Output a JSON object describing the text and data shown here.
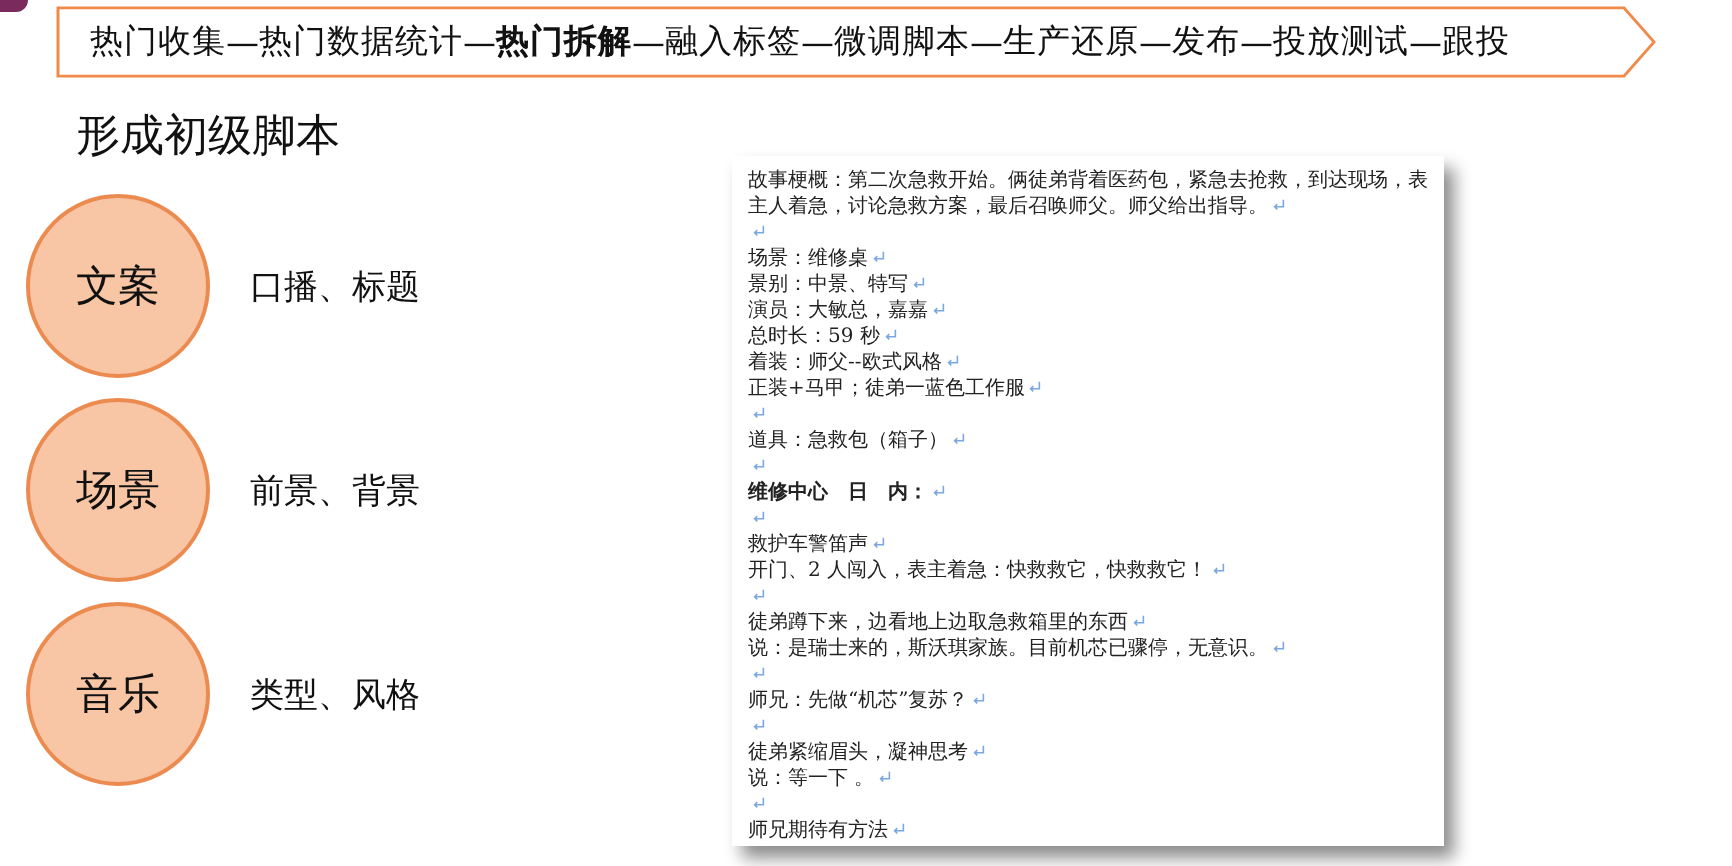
{
  "process_bar": {
    "separator": "—",
    "steps": [
      {
        "label": "热门收集",
        "selected": false
      },
      {
        "label": "热门数据统计",
        "selected": false
      },
      {
        "label": "热门拆解",
        "selected": true
      },
      {
        "label": "融入标签",
        "selected": false
      },
      {
        "label": "微调脚本",
        "selected": false
      },
      {
        "label": "生产还原",
        "selected": false
      },
      {
        "label": "发布",
        "selected": false
      },
      {
        "label": "投放测试",
        "selected": false
      },
      {
        "label": "跟投",
        "selected": false
      }
    ]
  },
  "title": "形成初级脚本",
  "elements": [
    {
      "name": "文案",
      "description": "口播、标题"
    },
    {
      "name": "场景",
      "description": "前景、背景"
    },
    {
      "name": "音乐",
      "description": "类型、风格"
    }
  ],
  "document": {
    "lines": [
      {
        "kind": "text",
        "text": "故事梗概：第二次急救开始。俩徒弟背着医药包，紧急去抢救，到达现场，表主人着急，讨论急救方案，最后召唤师父。师父给出指导。",
        "bold": false
      },
      {
        "kind": "blank"
      },
      {
        "kind": "text",
        "text": "场景：维修桌",
        "bold": false
      },
      {
        "kind": "text",
        "text": "景别：中景、特写",
        "bold": false
      },
      {
        "kind": "text",
        "text": "演员：大敏总，嘉嘉",
        "bold": false
      },
      {
        "kind": "text",
        "text": "总时长：59 秒",
        "bold": false
      },
      {
        "kind": "text",
        "text": "着装：师父--欧式风格",
        "bold": false
      },
      {
        "kind": "text",
        "text": "正装+马甲；徒弟一蓝色工作服",
        "bold": false
      },
      {
        "kind": "blank"
      },
      {
        "kind": "text",
        "text": "道具：急救包（箱子）",
        "bold": false
      },
      {
        "kind": "blank"
      },
      {
        "kind": "text",
        "text": "维修中心　日　内：",
        "bold": true
      },
      {
        "kind": "blank"
      },
      {
        "kind": "text",
        "text": "救护车警笛声",
        "bold": false
      },
      {
        "kind": "text",
        "text": "开门、2 人闯入，表主着急：快救救它，快救救它！",
        "bold": false
      },
      {
        "kind": "blank"
      },
      {
        "kind": "text",
        "text": "徒弟蹲下来，边看地上边取急救箱里的东西",
        "bold": false
      },
      {
        "kind": "text",
        "text": "说：是瑞士来的，斯沃琪家族。目前机芯已骤停，无意识。",
        "bold": false
      },
      {
        "kind": "blank"
      },
      {
        "kind": "text",
        "text": "师兄：先做“机芯”复苏？",
        "bold": false
      },
      {
        "kind": "blank"
      },
      {
        "kind": "text",
        "text": "徒弟紧缩眉头，凝神思考",
        "bold": false
      },
      {
        "kind": "text",
        "text": "说：等一下 。",
        "bold": false
      },
      {
        "kind": "blank"
      },
      {
        "kind": "text",
        "text": "师兄期待有方法",
        "bold": false
      }
    ]
  }
}
